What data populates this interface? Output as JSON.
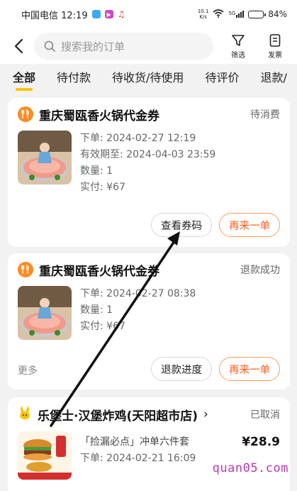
{
  "status_bar": {
    "carrier_time": "中国电信 12:19",
    "net_speed_value": "10.1",
    "net_speed_unit": "K/s",
    "signal_label": "5G",
    "battery_text": "84%",
    "battery_level": 0.84
  },
  "search": {
    "placeholder": "搜索我的订单",
    "filter_label": "筛选",
    "invoice_label": "发票"
  },
  "tabs": [
    "全部",
    "待付款",
    "待收货/待使用",
    "待评价",
    "退款/"
  ],
  "orders": [
    {
      "shop": "重庆蜀瓯香火锅代金券",
      "status": "待消费",
      "lines": [
        "下单: 2024-02-27 12:19",
        "有效期至: 2024-04-03 23:59",
        "数量: 1",
        "实付: ¥67"
      ],
      "buttons": [
        "查看券码",
        "再来一单"
      ]
    },
    {
      "shop": "重庆蜀瓯香火锅代金券",
      "status": "退款成功",
      "lines": [
        "下单: 2024-02-27 08:38",
        "数量: 1",
        "实付: ¥67"
      ],
      "more": "更多",
      "buttons": [
        "退款进度",
        "再来一单"
      ]
    },
    {
      "shop": "乐堡士·汉堡炸鸡(天阳超市店)",
      "status": "已取消",
      "item": "「捡漏必点」冲单六件套",
      "price": "¥28.9",
      "lines": [
        "下单: 2024-02-21 16:09"
      ]
    }
  ],
  "watermark": "quan05.com",
  "colors": {
    "accent_yellow": "#ffc300",
    "orange": "#ff5e1a",
    "annotation": "#111111"
  }
}
